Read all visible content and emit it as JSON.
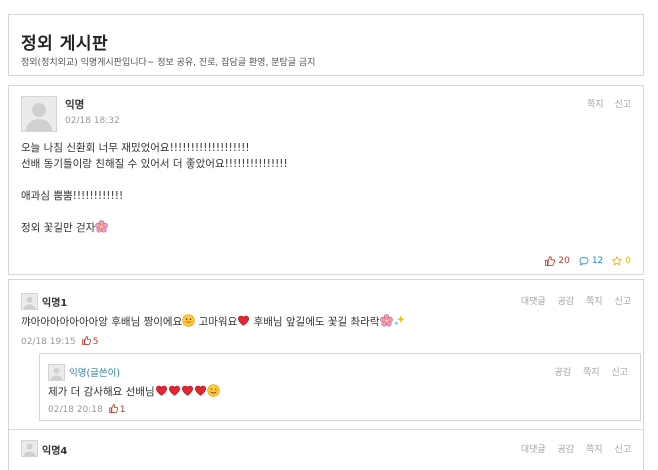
{
  "board": {
    "title": "정외 게시판",
    "description": "정외(정치외교) 익명게시판입니다~ 정보 공유, 진로, 잡담글 환영, 분탕글 금지"
  },
  "article": {
    "author": "익명",
    "date": "02/18 18:32",
    "actions": {
      "message": "쪽지",
      "report": "신고"
    },
    "lines": [
      "오늘 나침 신환회 너무 재밌었어요!!!!!!!!!!!!!!!!!!!",
      "선배 동기들이랑 친해질 수 있어서 더 좋았어요!!!!!!!!!!!!!!!",
      "",
      "애과심 뿜뿜!!!!!!!!!!!!",
      "",
      "정외 꽃길만 걷자"
    ],
    "stats": {
      "likes": "20",
      "comments": "12",
      "scraps": "0"
    }
  },
  "comments": [
    {
      "author": "익명1",
      "actions": {
        "reply": "대댓글",
        "like": "공감",
        "message": "쪽지",
        "report": "신고"
      },
      "text_parts": [
        "꺄아아아아아아아앙 후배님 짱이에요",
        " 고마워요",
        " 후배님 앞길에도 꽃길 촤라락"
      ],
      "date": "02/18 19:15",
      "likes": "5",
      "reply": {
        "author": "익명(글쓴이)",
        "actions": {
          "like": "공감",
          "message": "쪽지",
          "report": "신고"
        },
        "text": "제가 더 감사해요 선배님",
        "date": "02/18 20:18",
        "likes": "1"
      }
    },
    {
      "author": "익명4",
      "actions": {
        "reply": "대댓글",
        "like": "공감",
        "message": "쪽지",
        "report": "신고"
      }
    }
  ],
  "colors": {
    "like": "#c0392b",
    "comment": "#1d8fd1",
    "scrap": "#e6b800",
    "reply_author": "#2e7d9a"
  },
  "icons": {
    "avatar": "avatar-placeholder-icon",
    "like": "thumbs-up-icon",
    "comment": "speech-bubble-icon",
    "scrap": "star-icon",
    "flower": "cherry-blossom-emoji",
    "heart": "red-heart-emoji",
    "smile": "smiling-face-emoji",
    "sparkle": "sparkles-emoji"
  }
}
